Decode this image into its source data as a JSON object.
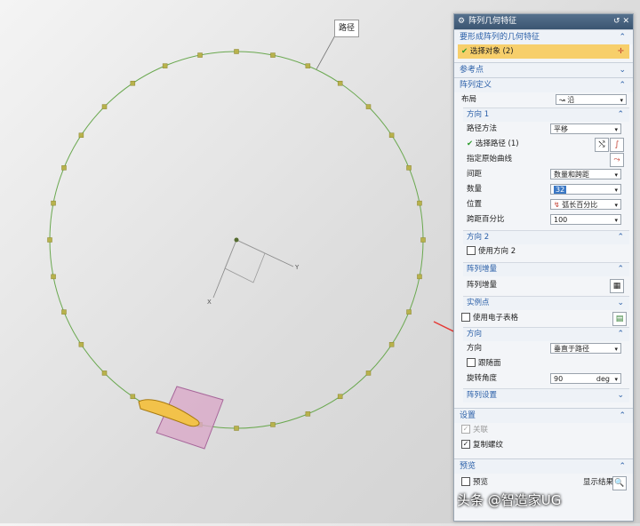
{
  "viewport": {
    "path_label": "路径",
    "axis_y": "Y",
    "axis_x": "X",
    "colors": {
      "circle": "#6aa84f",
      "marker": "#b8b24c",
      "plane": "#d9a9c8",
      "arrow": "#e53935"
    }
  },
  "dialog": {
    "title": "阵列几何特征",
    "section_objects": "要形成阵列的几何特征",
    "select_objects": "选择对象 (2)",
    "section_ref_point": "参考点",
    "section_definition": "阵列定义",
    "layout_label": "布局",
    "layout_value": "沿",
    "direction1": {
      "header": "方向 1",
      "path_method_label": "路径方法",
      "path_method_value": "平移",
      "select_path": "选择路径 (1)",
      "specify_curve": "指定原始曲线",
      "spacing_label": "间距",
      "spacing_value": "数量和跨距",
      "count_label": "数量",
      "count_value": "32",
      "position_label": "位置",
      "position_value": "弧长百分比",
      "span_label": "跨距百分比",
      "span_value": "100"
    },
    "direction2": {
      "header": "方向 2",
      "use_label": "使用方向 2"
    },
    "increment": {
      "header": "阵列增量",
      "label": "阵列增量"
    },
    "instance": {
      "header": "实例点",
      "spreadsheet_label": "使用电子表格"
    },
    "orientation": {
      "header": "方向",
      "label": "方向",
      "value": "垂直于路径",
      "follow_label": "跟随面",
      "angle_label": "旋转角度",
      "angle_value": "90",
      "angle_unit": "deg"
    },
    "settings_header": "阵列设置",
    "section_settings": "设置",
    "associative": "关联",
    "copy_threads": "复制螺纹",
    "section_preview": "预览",
    "preview_label": "预览",
    "show_result": "显示结果"
  },
  "watermark": "头条 @智造家UG"
}
